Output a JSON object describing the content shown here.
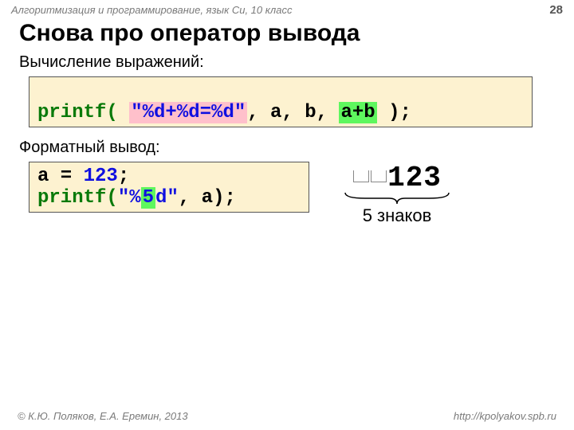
{
  "header": {
    "course": "Алгоритмизация и программирование, язык Си, 10 класс",
    "page": "28"
  },
  "title": "Снова про оператор вывода",
  "section1": {
    "label": "Вычисление выражений:",
    "code": {
      "p1": "printf( ",
      "fmt": "\"%d+%d=%d\"",
      "p2": ", a, b, ",
      "expr": "a+b",
      "p3": " );"
    }
  },
  "section2": {
    "label": "Форматный вывод:",
    "line1": {
      "p1": "a = ",
      "num": "123",
      "p2": ";"
    },
    "line2": {
      "p1": "printf(",
      "q1": "\"%",
      "hl": "5",
      "q2": "d\"",
      "p3": ", a);"
    },
    "output": "123",
    "brace_label": "5 знаков"
  },
  "footer": {
    "left": "© К.Ю. Поляков, Е.А. Еремин, 2013",
    "right": "http://kpolyakov.spb.ru"
  }
}
